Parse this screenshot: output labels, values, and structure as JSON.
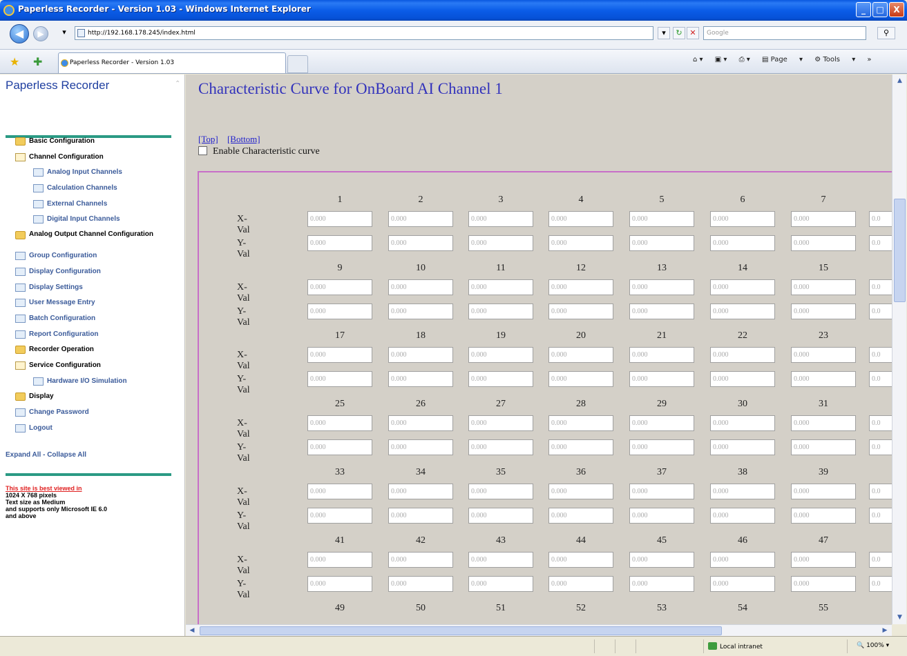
{
  "window": {
    "title": "Paperless Recorder - Version 1.03 - Windows Internet Explorer",
    "min": "_",
    "max": "□",
    "close": "X"
  },
  "address": {
    "url": "http://192.168.178.245/index.html",
    "search_placeholder": "Google"
  },
  "tab": {
    "title": "Paperless Recorder - Version 1.03"
  },
  "toolbar": {
    "page": "Page",
    "tools": "Tools"
  },
  "sidebar": {
    "brand": "Paperless Recorder",
    "items": [
      {
        "label": "Basic Configuration",
        "type": "folder"
      },
      {
        "label": "Channel Configuration",
        "type": "open"
      },
      {
        "label": "Analog Input Channels",
        "type": "sub"
      },
      {
        "label": "Calculation Channels",
        "type": "sub"
      },
      {
        "label": "External Channels",
        "type": "sub"
      },
      {
        "label": "Digital Input Channels",
        "type": "sub"
      },
      {
        "label": "Analog Output Channel Configuration",
        "type": "folder"
      },
      {
        "label": "Group Configuration",
        "type": "doc"
      },
      {
        "label": "Display Configuration",
        "type": "doc"
      },
      {
        "label": "Display Settings",
        "type": "doc"
      },
      {
        "label": "User Message Entry",
        "type": "doc"
      },
      {
        "label": "Batch Configuration",
        "type": "doc"
      },
      {
        "label": "Report Configuration",
        "type": "doc"
      },
      {
        "label": "Recorder Operation",
        "type": "folder"
      },
      {
        "label": "Service Configuration",
        "type": "open"
      },
      {
        "label": "Hardware I/O Simulation",
        "type": "sub"
      },
      {
        "label": "Display",
        "type": "folder"
      },
      {
        "label": "Change Password",
        "type": "doc"
      },
      {
        "label": "Logout",
        "type": "doc"
      }
    ],
    "expand_all": "Expand All",
    "separator": " - ",
    "collapse_all": "Collapse All",
    "note_link": "This site is best viewed in",
    "note_lines": [
      "1024 X 768 pixels",
      "Text size as Medium",
      "and supports only Microsoft IE 6.0",
      "and above"
    ]
  },
  "main": {
    "title": "Characteristic Curve for OnBoard AI Channel 1",
    "top_link": "[Top]",
    "bottom_link": "[Bottom]",
    "enable_label": "Enable Characteristic curve",
    "x_label": "X-Val",
    "y_label": "Y-Val",
    "default_value": "0.000",
    "partial_value": "0.0",
    "rows": [
      [
        "1",
        "2",
        "3",
        "4",
        "5",
        "6",
        "7"
      ],
      [
        "9",
        "10",
        "11",
        "12",
        "13",
        "14",
        "15"
      ],
      [
        "17",
        "18",
        "19",
        "20",
        "21",
        "22",
        "23"
      ],
      [
        "25",
        "26",
        "27",
        "28",
        "29",
        "30",
        "31"
      ],
      [
        "33",
        "34",
        "35",
        "36",
        "37",
        "38",
        "39"
      ],
      [
        "41",
        "42",
        "43",
        "44",
        "45",
        "46",
        "47"
      ],
      [
        "49",
        "50",
        "51",
        "52",
        "53",
        "54",
        "55"
      ]
    ]
  },
  "status": {
    "zone": "Local intranet",
    "zoom": "100%"
  }
}
